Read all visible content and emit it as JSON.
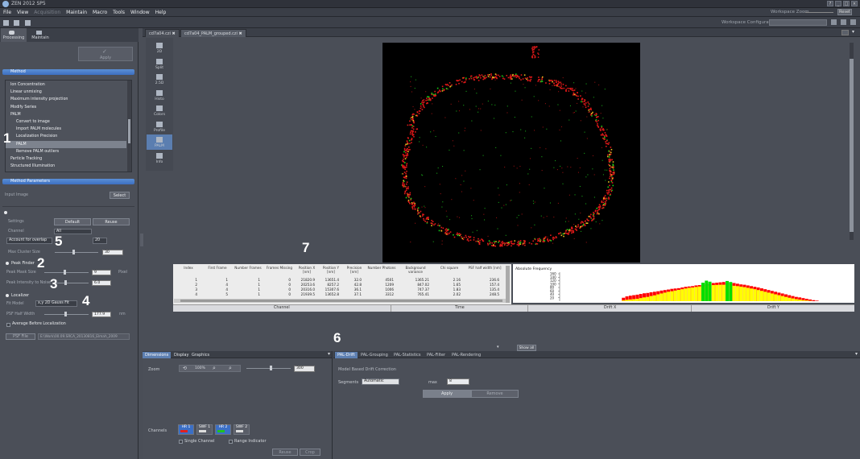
{
  "app": {
    "title": "ZEN 2012 SP5"
  },
  "menubar": [
    "File",
    "View",
    "Acquisition",
    "Maintain",
    "Macro",
    "Tools",
    "Window",
    "Help"
  ],
  "workspace": {
    "zoom_label": "Workspace Zoom",
    "reset_label": "Reset",
    "config_label": "Workspace Configuration"
  },
  "left_tabs": [
    "Processing",
    "Maintain"
  ],
  "apply_label": "Apply",
  "method": {
    "header": "Method",
    "items": [
      {
        "label": "Ion Concentration",
        "indent": 0
      },
      {
        "label": "Linear unmixing",
        "indent": 0
      },
      {
        "label": "Maximum intensity projection",
        "indent": 0
      },
      {
        "label": "Modify Series",
        "indent": 0
      },
      {
        "label": "PALM",
        "indent": 0
      },
      {
        "label": "Convert to image",
        "indent": 1
      },
      {
        "label": "Import PALM molecules",
        "indent": 1
      },
      {
        "label": "Localization Precision",
        "indent": 1
      },
      {
        "label": "PALM",
        "indent": 1,
        "selected": true
      },
      {
        "label": "Remove PALM outliers",
        "indent": 1
      },
      {
        "label": "Particle Tracking",
        "indent": 0
      },
      {
        "label": "Structured Illumination",
        "indent": 0
      }
    ]
  },
  "params": {
    "header": "Method Parameters",
    "input_image_label": "Input Image",
    "select_label": "Select",
    "settings_label": "Settings",
    "default_label": "Default",
    "reuse_label": "Reuse",
    "channel_label": "Channel",
    "channel_value": "All",
    "overlap_value": "Account for overlap",
    "overlap_num": "20",
    "max_cluster_label": "Max Cluster Size",
    "max_cluster_value": "30",
    "peak_finder_label": "Peak Finder",
    "peak_mask_label": "Peak Mask Size",
    "peak_mask_value": "9",
    "peak_mask_unit": "Pixel",
    "peak_intensity_label": "Peak Intensity to Noise",
    "peak_intensity_value": "6.0",
    "localizer_label": "Localizer",
    "fit_model_label": "Fit Model",
    "fit_model_value": "x,y 2D Gauss Fit",
    "psf_label": "PSF Half Width",
    "psf_value": "177.9",
    "psf_unit": "nm",
    "average_label": "Average Before Localization",
    "psf_file_label": "PSF File",
    "psf_file_path": "E:\\Work\\00.09.SRCA_20130816_Elmah_2009"
  },
  "vertical_tools": [
    "2D",
    "Split",
    "2.5D",
    "Histo",
    "Colors",
    "Profile",
    "PALM",
    "Info"
  ],
  "doc_tabs": [
    "cd7a04.czi",
    "cd7a04_PALM_grouped.czi"
  ],
  "table": {
    "headers": [
      "Index",
      "First Frame",
      "Number Frames",
      "Frames Missing",
      "Position X [nm]",
      "Position Y [nm]",
      "Precision [nm]",
      "Number Photons",
      "Background variance",
      "Chi square",
      "PSF half width [nm]"
    ],
    "rows": [
      [
        "1",
        "1",
        "1",
        "0",
        "21820.9",
        "13651.4",
        "32.0",
        "4501",
        "1365.21",
        "2.16",
        "236.6"
      ],
      [
        "2",
        "4",
        "1",
        "0",
        "20253.6",
        "8257.2",
        "42.8",
        "1209",
        "847.02",
        "1.65",
        "157.4"
      ],
      [
        "3",
        "4",
        "1",
        "0",
        "20316.0",
        "15307.6",
        "36.1",
        "1006",
        "747.37",
        "1.83",
        "135.4"
      ],
      [
        "4",
        "5",
        "1",
        "0",
        "21939.5",
        "13652.8",
        "37.1",
        "3312",
        "765.41",
        "2.02",
        "248.5"
      ]
    ]
  },
  "histogram": {
    "title": "Absolute Frequency",
    "yticks": [
      "160",
      "140",
      "120",
      "100",
      "80",
      "60",
      "40",
      "20"
    ]
  },
  "chart_data": {
    "type": "bar",
    "title": "Absolute Frequency",
    "ylim": [
      0,
      160
    ],
    "series": [
      {
        "color": "#ffff00",
        "values": [
          0,
          0,
          0,
          0,
          0,
          0,
          0,
          0,
          0,
          0,
          0,
          0,
          0,
          0,
          0,
          0,
          0,
          0,
          5,
          8,
          10,
          12,
          14,
          18,
          22,
          25,
          30,
          34,
          40,
          45,
          50,
          55,
          58,
          62,
          66,
          70,
          74,
          78,
          80,
          83,
          86,
          88,
          90,
          92,
          94,
          95,
          96,
          96,
          95,
          93,
          90,
          88,
          85,
          82,
          78,
          74,
          70,
          65,
          60,
          55,
          50,
          45,
          40,
          35,
          30,
          25,
          20,
          16,
          12,
          9,
          6,
          4,
          2,
          0,
          0,
          0,
          0,
          0,
          0,
          0,
          0,
          0
        ]
      },
      {
        "color": "#ff0000",
        "values": [
          0,
          0,
          0,
          0,
          0,
          0,
          0,
          0,
          0,
          0,
          0,
          0,
          0,
          0,
          0,
          0,
          0,
          0,
          20,
          28,
          32,
          35,
          38,
          42,
          46,
          48,
          52,
          55,
          58,
          62,
          65,
          68,
          72,
          74,
          76,
          80,
          84,
          86,
          88,
          92,
          94,
          96,
          100,
          104,
          106,
          108,
          110,
          112,
          110,
          108,
          106,
          102,
          98,
          96,
          92,
          88,
          84,
          80,
          75,
          70,
          65,
          60,
          55,
          50,
          45,
          40,
          35,
          30,
          25,
          22,
          18,
          14,
          10,
          6,
          3,
          0,
          0,
          0,
          0,
          0,
          0,
          0
        ]
      },
      {
        "color": "#00dd00",
        "values": [
          0,
          0,
          0,
          0,
          0,
          0,
          0,
          0,
          0,
          0,
          0,
          0,
          0,
          0,
          0,
          0,
          0,
          0,
          0,
          0,
          0,
          0,
          0,
          0,
          0,
          0,
          0,
          0,
          0,
          0,
          0,
          0,
          0,
          0,
          0,
          0,
          0,
          0,
          0,
          0,
          0,
          108,
          120,
          114,
          0,
          0,
          0,
          0,
          118,
          112,
          0,
          0,
          0,
          0,
          0,
          0,
          0,
          0,
          0,
          0,
          0,
          0,
          0,
          0,
          0,
          0,
          0,
          0,
          0,
          0,
          0,
          0,
          0,
          0,
          0,
          0,
          0,
          0,
          0,
          0,
          0,
          0
        ]
      }
    ]
  },
  "trackbar": [
    "Channel",
    "Time",
    "Drift X",
    "Drift Y"
  ],
  "show_all_label": "Show all",
  "bottom_left_tabs": [
    "Dimensions",
    "Display",
    "Graphics"
  ],
  "zoom_label": "Zoom",
  "zoom_value": "300",
  "zoom_btns": [
    "",
    "100%",
    "",
    ""
  ],
  "channels_label": "Channels",
  "channel_buttons": [
    {
      "name": "HR 1",
      "active": true
    },
    {
      "name": "SWF 1",
      "active": false
    },
    {
      "name": "HR 2",
      "active": true
    },
    {
      "name": "SWF 2",
      "active": false
    }
  ],
  "single_channel_label": "Single Channel",
  "range_indicator_label": "Range Indicator",
  "reuse_bottom_label": "Reuse",
  "crop_label": "Crop",
  "pal_tabs": [
    "PAL-Drift",
    "PAL-Grouping",
    "PAL-Statistics",
    "PAL-Filter",
    "PAL-Rendering"
  ],
  "drift": {
    "title": "Model Based Drift Correction",
    "segments_label": "Segments",
    "segments_value": "Automatic",
    "max_label": "max",
    "max_value": "8",
    "apply_label": "Apply",
    "remove_label": "Remove"
  },
  "annotations": [
    "1",
    "2",
    "3",
    "4",
    "5",
    "6",
    "7"
  ]
}
